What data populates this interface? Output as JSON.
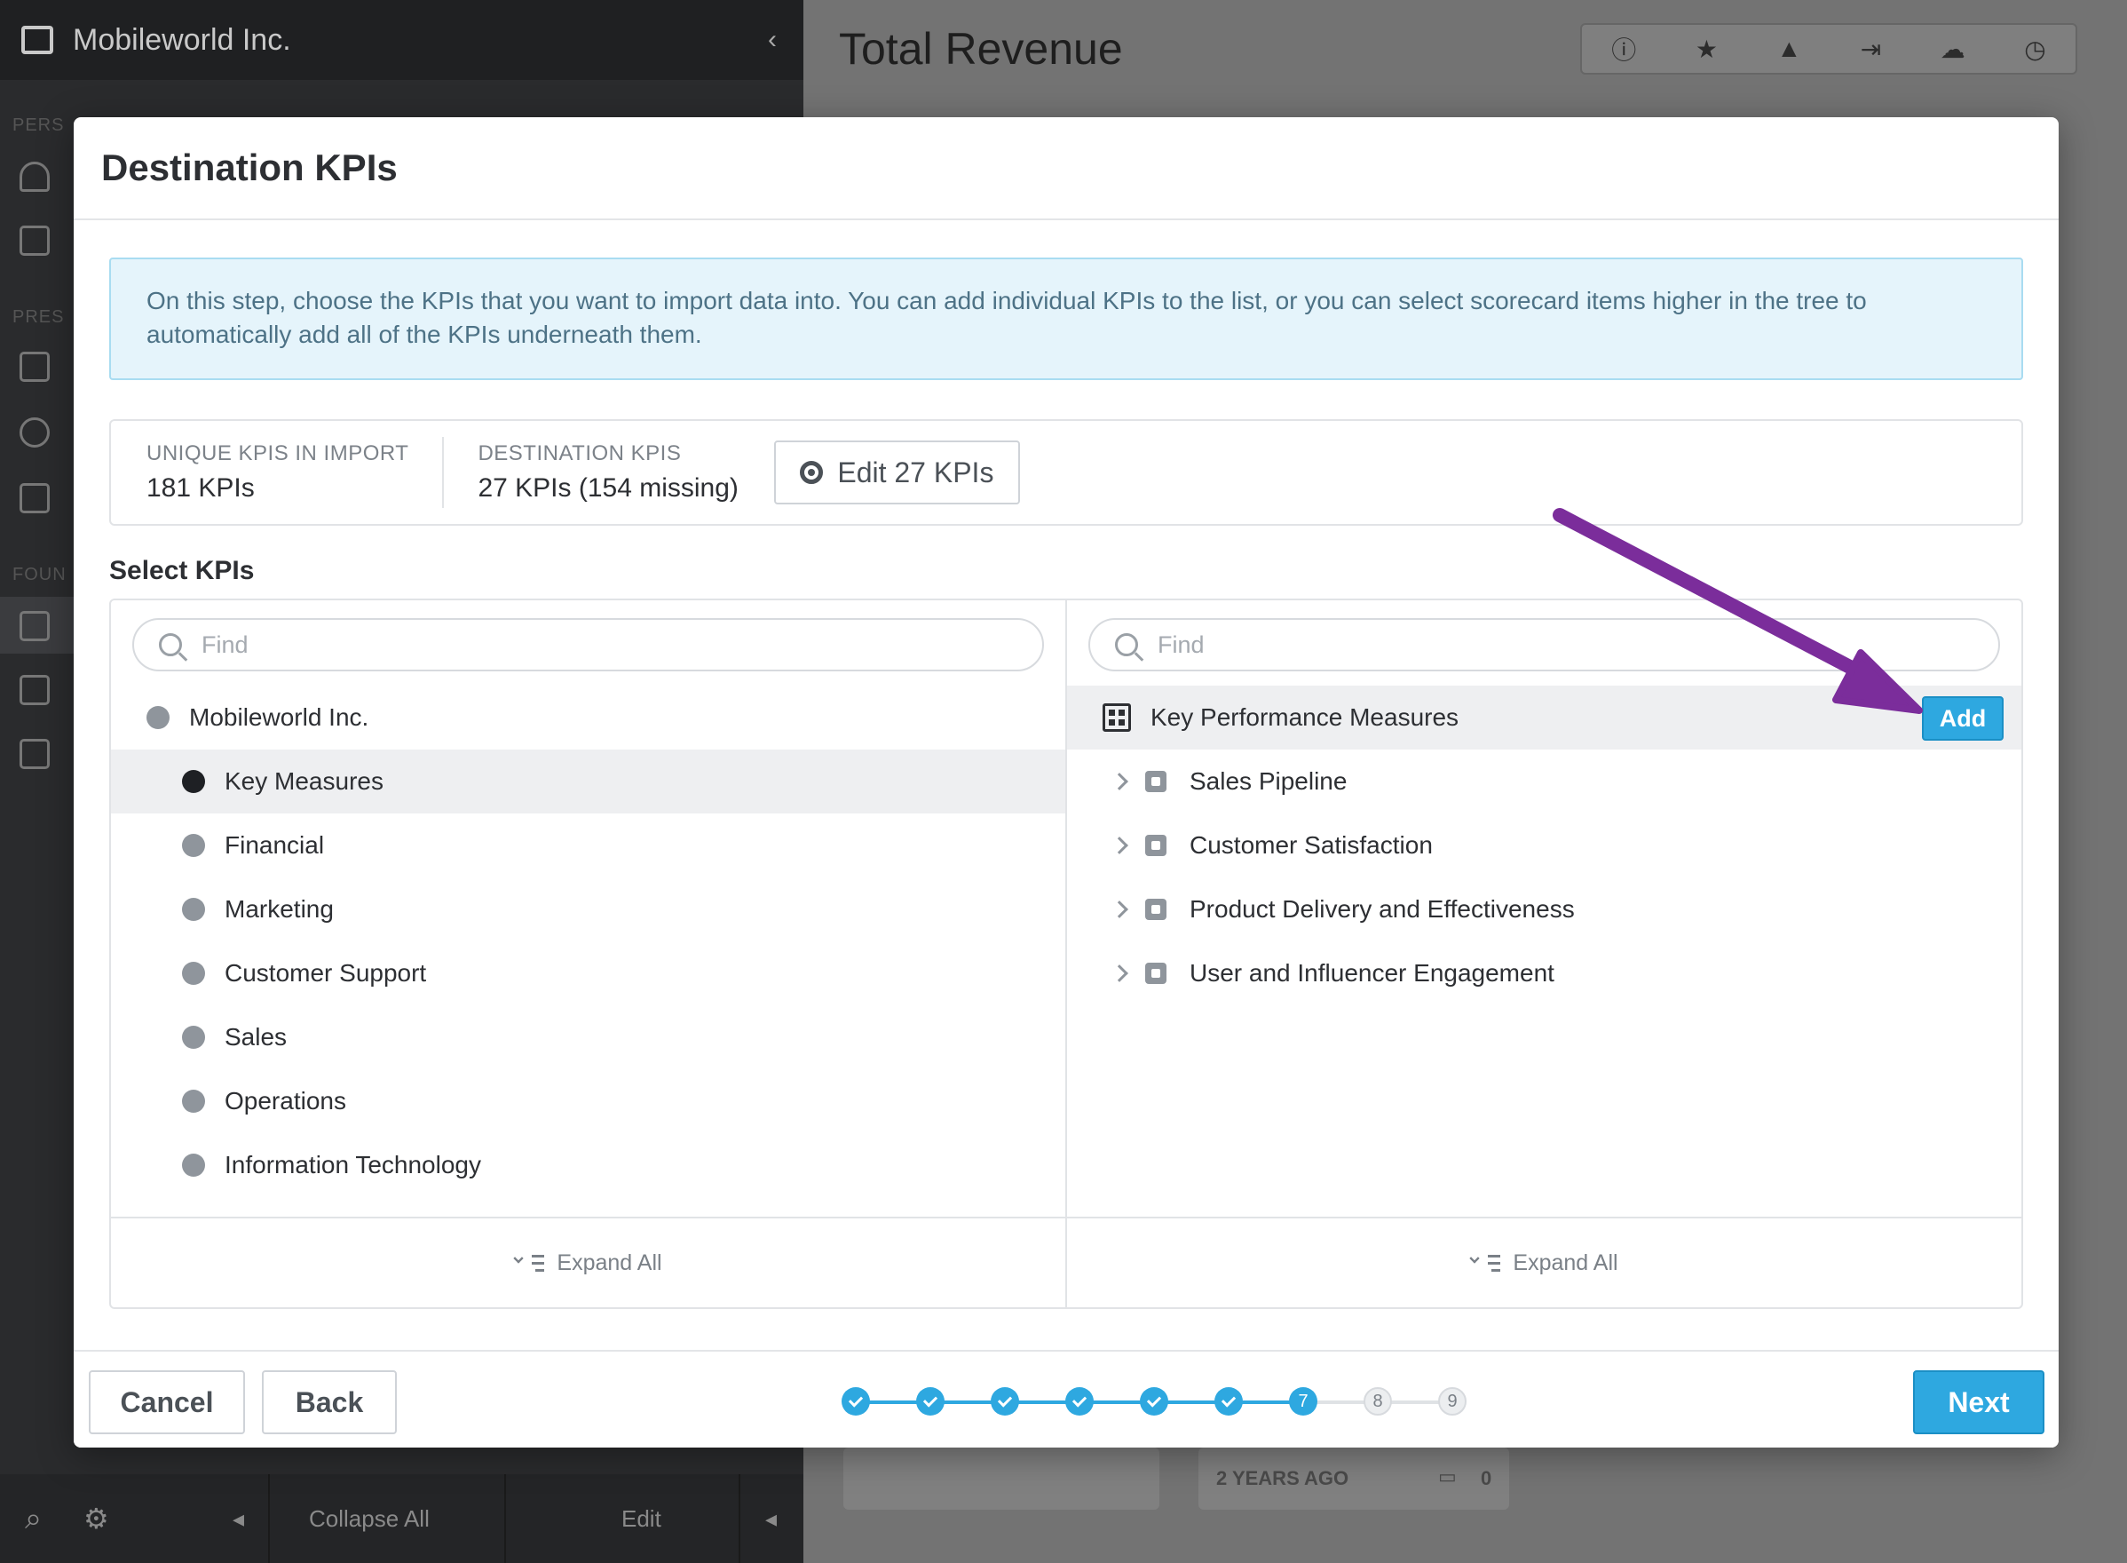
{
  "background": {
    "org_name": "Mobileworld Inc.",
    "page_title": "Total Revenue",
    "sidebar_labels": [
      "PERS",
      "PRES",
      "FOUN"
    ],
    "bottom_bar": {
      "collapse_all": "Collapse All",
      "edit": "Edit"
    },
    "card_text": "2 YEARS AGO",
    "comment_count": "0",
    "toolbar_icons": [
      "info-icon",
      "star-icon",
      "alert-icon",
      "share-icon",
      "cloud-icon",
      "clock-icon"
    ]
  },
  "modal": {
    "title": "Destination KPIs",
    "info_text": "On this step, choose the KPIs that you want to import data into. You can add individual KPIs to the list, or you can select scorecard items higher in the tree to automatically add all of the KPIs underneath them.",
    "stats": {
      "unique_label": "UNIQUE KPIS IN IMPORT",
      "unique_value": "181 KPIs",
      "dest_label": "DESTINATION KPIS",
      "dest_value": "27 KPIs (154 missing)",
      "edit_button": "Edit 27 KPIs"
    },
    "select_label": "Select KPIs",
    "left_panel": {
      "find_placeholder": "Find",
      "root": "Mobileworld Inc.",
      "items": [
        {
          "label": "Key Measures",
          "selected": true
        },
        {
          "label": "Financial",
          "selected": false
        },
        {
          "label": "Marketing",
          "selected": false
        },
        {
          "label": "Customer Support",
          "selected": false
        },
        {
          "label": "Sales",
          "selected": false
        },
        {
          "label": "Operations",
          "selected": false
        },
        {
          "label": "Information Technology",
          "selected": false
        }
      ],
      "expand_all": "Expand All"
    },
    "right_panel": {
      "find_placeholder": "Find",
      "root": "Key Performance Measures",
      "add_button": "Add",
      "items": [
        {
          "label": "Sales Pipeline"
        },
        {
          "label": "Customer Satisfaction"
        },
        {
          "label": "Product Delivery and Effectiveness"
        },
        {
          "label": "User and Influencer Engagement"
        }
      ],
      "expand_all": "Expand All"
    },
    "footer": {
      "cancel": "Cancel",
      "back": "Back",
      "next": "Next",
      "steps_total": 9,
      "current_step": 7,
      "step_labels": [
        "1",
        "2",
        "3",
        "4",
        "5",
        "6",
        "7",
        "8",
        "9"
      ]
    }
  },
  "colors": {
    "accent": "#2ea8e0",
    "annotation_arrow": "#7b2d9b",
    "info_bg": "#e5f4fb"
  }
}
